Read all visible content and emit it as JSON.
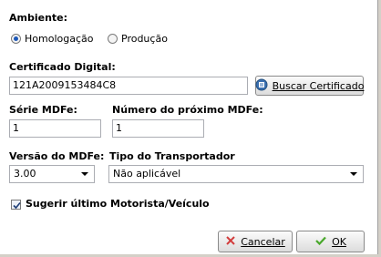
{
  "ambiente": {
    "label": "Ambiente:",
    "options": [
      {
        "label": "Homologação",
        "selected": true
      },
      {
        "label": "Produção",
        "selected": false
      }
    ]
  },
  "certificado": {
    "label": "Certificado Digital:",
    "value": "121A2009153484C8",
    "search_button": "Buscar Certificado"
  },
  "serie": {
    "label": "Série MDFe:",
    "value": "1"
  },
  "proximo": {
    "label": "Número do próximo MDFe:",
    "value": "1"
  },
  "versao": {
    "label": "Versão do MDFe:",
    "value": "3.00"
  },
  "transportador": {
    "label": "Tipo do Transportador",
    "value": "Não aplicável"
  },
  "sugerir": {
    "label": "Sugerir último Motorista/Veículo",
    "checked": true
  },
  "buttons": {
    "cancel": "Cancelar",
    "ok": "OK"
  },
  "colors": {
    "radio_dot": "#1c58b8",
    "cancel_x": "#d23b3b",
    "ok_check": "#49a82c",
    "certificate_icon": "#3a6fb0"
  }
}
